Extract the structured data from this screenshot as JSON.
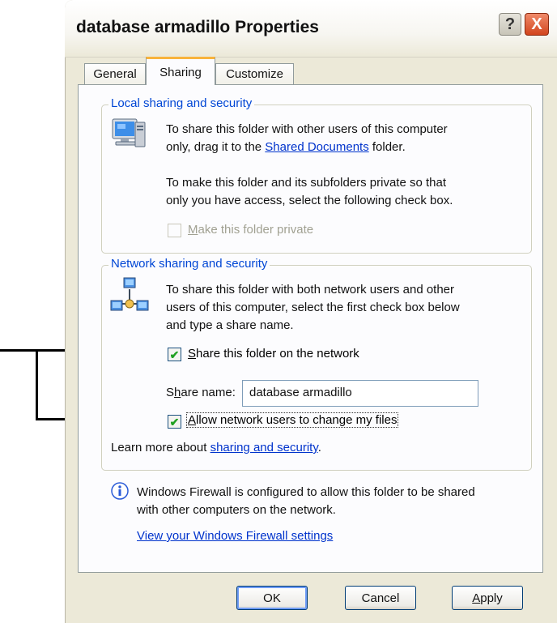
{
  "window": {
    "title": "database armadillo Properties"
  },
  "titlebar_buttons": {
    "help": "?",
    "close": "X"
  },
  "tabs": [
    {
      "label": "General",
      "active": false
    },
    {
      "label": "Sharing",
      "active": true
    },
    {
      "label": "Customize",
      "active": false
    }
  ],
  "local": {
    "legend": "Local sharing and security",
    "text1_pre": "To share this folder with other users of this computer",
    "text1_line2_pre": "only, drag it to the ",
    "text1_link": "Shared Documents",
    "text1_post": " folder.",
    "text2_line1": "To make this folder and its subfolders private so that",
    "text2_line2": "only you have access, select the following check box.",
    "private_checkbox": {
      "mnemonic": "M",
      "label_rest": "ake this folder private",
      "checked": false,
      "enabled": false
    }
  },
  "network": {
    "legend": "Network sharing and security",
    "text_line1": "To share this folder with both network users and other",
    "text_line2": "users of this computer, select the first check box below",
    "text_line3": "and type a share name.",
    "share_checkbox": {
      "mnemonic": "S",
      "label_rest": "hare this folder on the network",
      "checked": true,
      "mark": "✔"
    },
    "share_name_label_pre": "S",
    "share_name_label_mnemonic": "h",
    "share_name_label_post": "are name:",
    "share_name_value": "database armadillo",
    "allow_checkbox": {
      "mnemonic": "A",
      "label_rest": "llow network users to change my files",
      "checked": true,
      "mark": "✔"
    },
    "learn_more_pre": "Learn more about ",
    "learn_more_link": "sharing and security",
    "learn_more_post": "."
  },
  "firewall": {
    "info_icon": "info-icon",
    "line1": "Windows Firewall is configured to allow this folder to be shared",
    "line2": "with other computers on the network.",
    "link": "View your Windows Firewall settings"
  },
  "buttons": {
    "ok": "OK",
    "cancel": "Cancel",
    "apply_mnemonic": "A",
    "apply_rest": "pply"
  },
  "icons": {
    "computer": "computer-icon",
    "network": "network-share-icon"
  }
}
